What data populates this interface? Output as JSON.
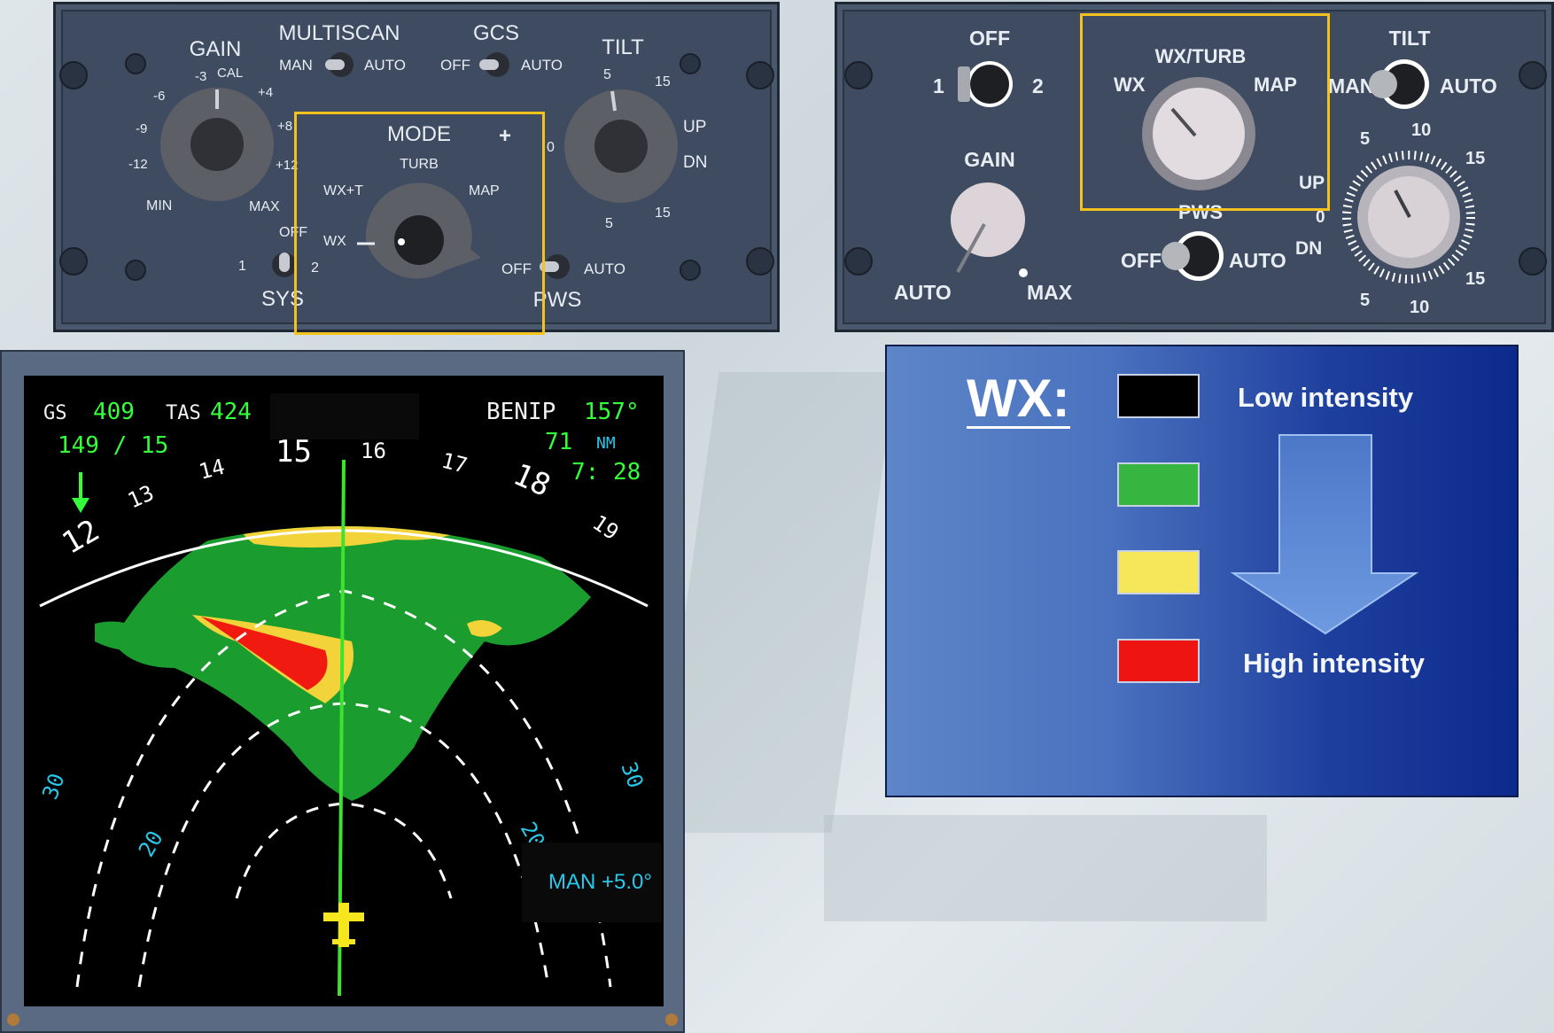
{
  "left_panel": {
    "gain": {
      "title": "GAIN",
      "ticks": [
        "-3",
        "CAL",
        "+4",
        "-6",
        "+8",
        "-9",
        "-12",
        "+12",
        "MIN",
        "MAX"
      ]
    },
    "multiscan": {
      "title": "MULTISCAN",
      "left": "MAN",
      "right": "AUTO"
    },
    "gcs": {
      "title": "GCS",
      "left": "OFF",
      "right": "AUTO"
    },
    "tilt": {
      "title": "TILT",
      "up": "UP",
      "dn": "DN",
      "ticks": [
        "5",
        "15",
        "0",
        "5",
        "15"
      ]
    },
    "mode": {
      "title": "MODE",
      "plus": "+",
      "turb": "TURB",
      "wxt": "WX+T",
      "map": "MAP",
      "wx": "WX"
    },
    "sys": {
      "title": "SYS",
      "off": "OFF",
      "one": "1",
      "two": "2"
    },
    "pws": {
      "title": "PWS",
      "off": "OFF",
      "auto": "AUTO"
    }
  },
  "right_panel": {
    "sys": {
      "off": "OFF",
      "one": "1",
      "two": "2"
    },
    "mode": {
      "title": "WX/TURB",
      "wx": "WX",
      "map": "MAP"
    },
    "tilt": {
      "title": "TILT",
      "man": "MAN",
      "auto": "AUTO",
      "up": "UP",
      "zero": "0",
      "dn": "DN",
      "t10a": "10",
      "t5a": "5",
      "t15a": "15",
      "t15b": "15",
      "t5b": "5",
      "t10b": "10"
    },
    "gain": {
      "title": "GAIN",
      "auto": "AUTO",
      "max": "MAX"
    },
    "pws": {
      "title": "PWS",
      "off": "OFF",
      "auto": "AUTO"
    }
  },
  "display": {
    "gs_label": "GS",
    "gs": "409",
    "tas_label": "TAS",
    "tas": "424",
    "wind": "149 / 15",
    "waypoint": "BENIP",
    "bearing": "157°",
    "distance": "71",
    "dist_unit": "NM",
    "eta": "7: 28",
    "headings": [
      "12",
      "13",
      "14",
      "15",
      "16",
      "17",
      "18",
      "19"
    ],
    "ranges": [
      "30",
      "20",
      "20",
      "30"
    ],
    "tilt_readout": "MAN +5.0°",
    "colors": {
      "black": "#000000",
      "green": "#1a9c2e",
      "yellow": "#f2d43a",
      "red": "#f01a10",
      "aircraft": "#f5e61e"
    }
  },
  "legend": {
    "title": "WX:",
    "low": "Low intensity",
    "high": "High intensity",
    "swatches": [
      "#000000",
      "#36b540",
      "#f6e65a",
      "#ee1411"
    ]
  },
  "highlight_color": "#f3c21d"
}
